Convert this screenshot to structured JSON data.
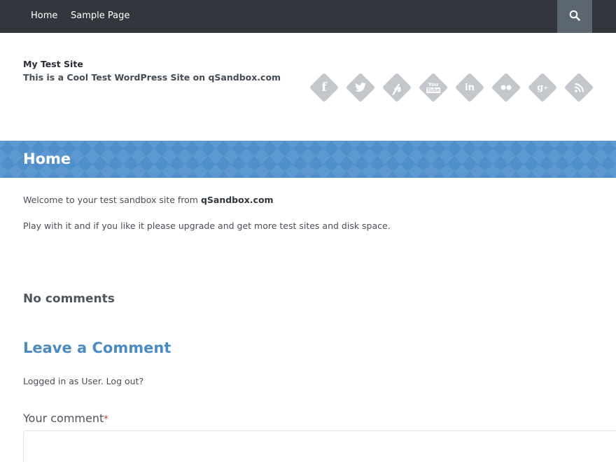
{
  "nav": {
    "home_label": "Home",
    "sample_label": "Sample Page",
    "search_icon": "search-icon"
  },
  "header": {
    "site_title": "My Test Site",
    "site_description": "This is a Cool Test WordPress Site on qSandbox.com"
  },
  "social": [
    {
      "name": "facebook-icon",
      "glyph": "f"
    },
    {
      "name": "twitter-icon",
      "glyph": "t"
    },
    {
      "name": "pinterest-icon",
      "glyph": "p"
    },
    {
      "name": "youtube-icon",
      "glyph": "You Tube"
    },
    {
      "name": "linkedin-icon",
      "glyph": "in"
    },
    {
      "name": "flickr-icon",
      "glyph": "●●"
    },
    {
      "name": "google-plus-icon",
      "glyph": "g+"
    },
    {
      "name": "rss-icon",
      "glyph": "rss"
    }
  ],
  "banner": {
    "title": "Home",
    "color": "#4f8fcc"
  },
  "content": {
    "para1_text": "Welcome to your test sandbox site from ",
    "para1_link": "qSandbox.com",
    "para2": "Play with it and if you like it please upgrade and get more test sites and disk space."
  },
  "comments": {
    "no_comments": "No comments",
    "leave_heading": "Leave a Comment",
    "logged_in_prefix": "Logged in as ",
    "user_link": "User",
    "logout_link": "Log out?",
    "comment_label": "Your comment",
    "required_mark": "*"
  }
}
